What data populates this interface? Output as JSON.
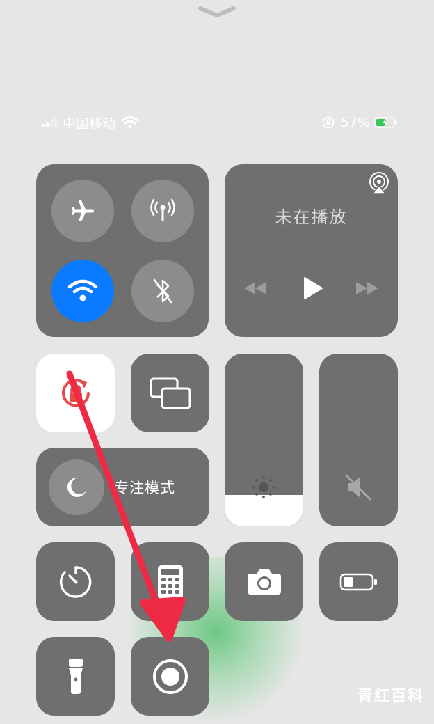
{
  "status_bar": {
    "carrier": "中国移动",
    "battery_percent": "57%"
  },
  "connectivity": {
    "airplane": "off",
    "cellular": "off",
    "wifi": "on",
    "bluetooth": "off"
  },
  "now_playing": {
    "title": "未在播放"
  },
  "focus": {
    "label": "专注模式"
  },
  "brightness": {
    "level": 0.18
  },
  "watermark": "青红百科",
  "colors": {
    "wifi_active": "#0a7bff",
    "rotation_lock_icon": "#e84a4a",
    "annotation_arrow": "#ee2a45",
    "tile_bg": "#6f6f6f"
  }
}
